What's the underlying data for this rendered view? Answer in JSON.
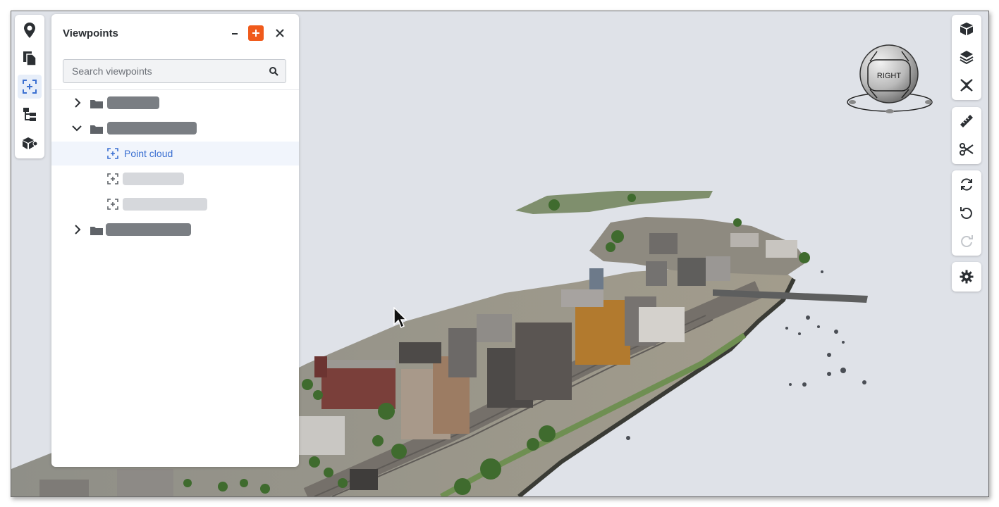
{
  "panel": {
    "title": "Viewpoints",
    "search_placeholder": "Search viewpoints",
    "tree": [
      {
        "type": "folder",
        "expanded": false,
        "label_redacted": true
      },
      {
        "type": "folder",
        "expanded": true,
        "label_redacted": true,
        "children": [
          {
            "type": "viewpoint",
            "label": "Point cloud",
            "selected": true
          },
          {
            "type": "viewpoint",
            "label_redacted": true
          },
          {
            "type": "viewpoint",
            "label_redacted": true
          }
        ]
      },
      {
        "type": "folder",
        "expanded": false,
        "label_redacted": true
      }
    ]
  },
  "left_toolbar": [
    "location-pin-icon",
    "documents-icon",
    "viewpoints-icon",
    "tree-icon",
    "models-icon"
  ],
  "navcube": {
    "face_label": "RIGHT"
  },
  "right_toolbar": {
    "group1": [
      "cube-icon",
      "layers-icon",
      "section-plane-icon"
    ],
    "group2": [
      "ruler-icon",
      "scissors-icon"
    ],
    "group3": [
      "refresh-icon",
      "undo-icon",
      "redo-icon"
    ],
    "group4": [
      "settings-icon"
    ]
  },
  "colors": {
    "accent": "#f05a1b",
    "selected_text": "#3a6fd1",
    "background": "#dfe2e8"
  }
}
